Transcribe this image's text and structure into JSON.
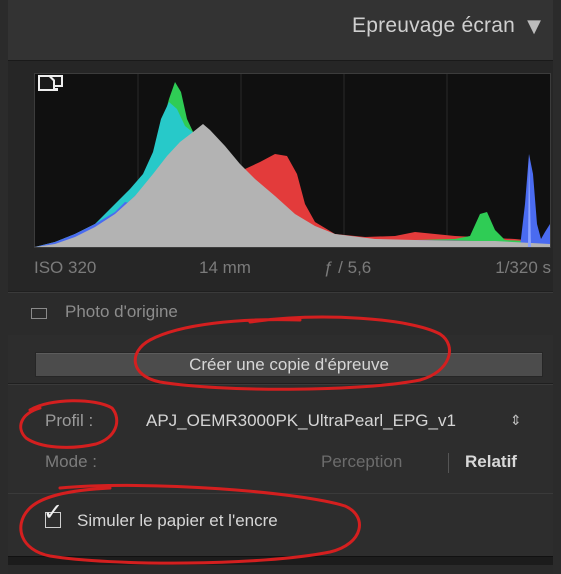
{
  "header": {
    "title": "Epreuvage écran",
    "toggle_icon": "triangle-down-icon"
  },
  "histogram": {
    "left_icon": "monitor-icon",
    "right_icon": "page-icon",
    "colors": {
      "luminance": "#b3b3b3",
      "red": "#e33b3b",
      "green": "#2fcc55",
      "blue": "#4a6bf0",
      "cyan": "#27c9c9",
      "magenta": "#e12fd4",
      "background": "#101010"
    },
    "meta": {
      "iso": "ISO 320",
      "focal": "14 mm",
      "aperture": "ƒ / 5,6",
      "shutter": "1/320 s"
    }
  },
  "original": {
    "label": "Photo d'origine",
    "checked": false
  },
  "copy_button": {
    "label": "Créer une copie d'épreuve"
  },
  "profile": {
    "label": "Profil :",
    "value": "APJ_OEMR3000PK_UltraPearl_EPG_v1",
    "arrow": "⇕"
  },
  "mode": {
    "label": "Mode :",
    "option_1": "Perception",
    "option_2": "Relatif",
    "selected": "Relatif"
  },
  "simulate": {
    "label": "Simuler le papier et l'encre",
    "checked": true,
    "checkmark": "✓"
  },
  "annotation_color": "#d41f1f"
}
